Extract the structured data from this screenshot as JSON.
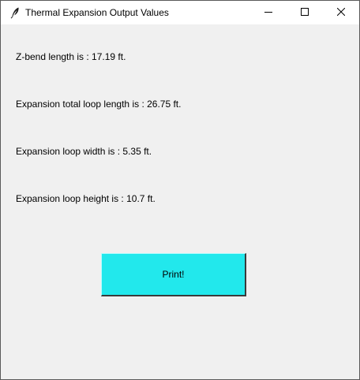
{
  "window": {
    "title": "Thermal Expansion Output Values",
    "icons": {
      "app": "feather-icon",
      "minimize": "minimize-icon",
      "maximize": "maximize-icon",
      "close": "close-icon"
    }
  },
  "results": {
    "z_bend": "Z-bend length is : 17.19 ft.",
    "loop_total": "Expansion total loop length is : 26.75 ft.",
    "loop_width": "Expansion loop width is : 5.35 ft.",
    "loop_height": "Expansion loop height is : 10.7 ft."
  },
  "actions": {
    "print_label": "Print!"
  },
  "colors": {
    "print_button_bg": "#22e8ec",
    "window_bg": "#f0f0f0"
  }
}
